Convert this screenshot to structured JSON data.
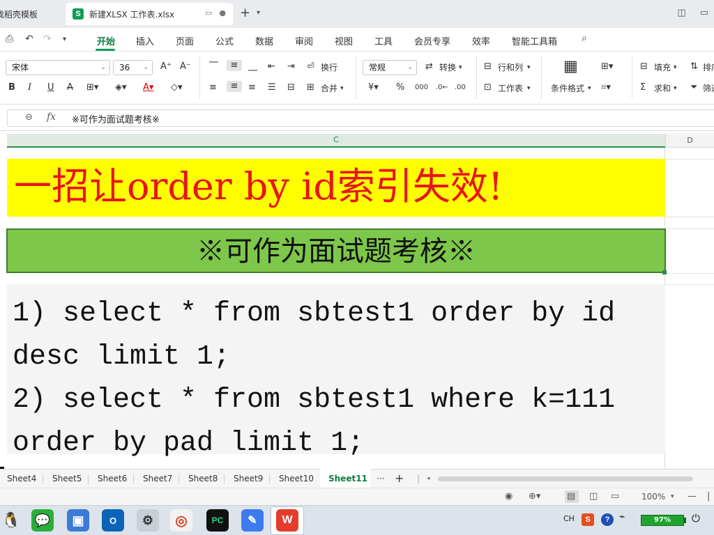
{
  "tabs": {
    "template_tab_label": "找稻壳模板",
    "active_tab_label": "新建XLSX 工作表.xlsx",
    "app_badge": "S"
  },
  "menu": {
    "items": [
      "开始",
      "插入",
      "页面",
      "公式",
      "数据",
      "审阅",
      "视图",
      "工具",
      "会员专享",
      "效率",
      "智能工具箱"
    ]
  },
  "ribbon": {
    "font_name": "宋体",
    "font_size": "36",
    "wrap_label": "换行",
    "merge_label": "合并",
    "number_format": "常规",
    "convert_label": "转换",
    "rows_cols_label": "行和列",
    "worksheet_label": "工作表",
    "cond_format_label": "条件格式",
    "fill_label": "填充",
    "sum_label": "求和",
    "sort_label": "排序",
    "filter_label": "筛选"
  },
  "formula_bar": {
    "fx_label": "fx",
    "content": "※可作为面试题考核※"
  },
  "columns": {
    "c": "C",
    "d": "D"
  },
  "cells": {
    "title": "一招让order by id索引失效!",
    "subtitle": "※可作为面试题考核※",
    "code_lines": [
      "1) select * from sbtest1 order by id",
      "desc limit 1;",
      "2) select * from sbtest1 where k=111",
      "order by pad limit 1;"
    ]
  },
  "sheet_tabs": {
    "items": [
      "Sheet4",
      "Sheet5",
      "Sheet6",
      "Sheet7",
      "Sheet8",
      "Sheet9",
      "Sheet10",
      "Sheet11"
    ],
    "active": "Sheet11",
    "more_label": "···",
    "add_label": "+"
  },
  "status": {
    "zoom": "100%"
  },
  "taskbar": {
    "ime_label": "CH",
    "battery": "97%",
    "pycharm_label": "PC",
    "outlook_label": "O"
  },
  "colors": {
    "accent_green": "#0f9d58",
    "title_fill": "#ffff00",
    "title_text": "#e8141c",
    "subtitle_fill": "#7dc74a",
    "code_fill": "#f4f4f4"
  }
}
